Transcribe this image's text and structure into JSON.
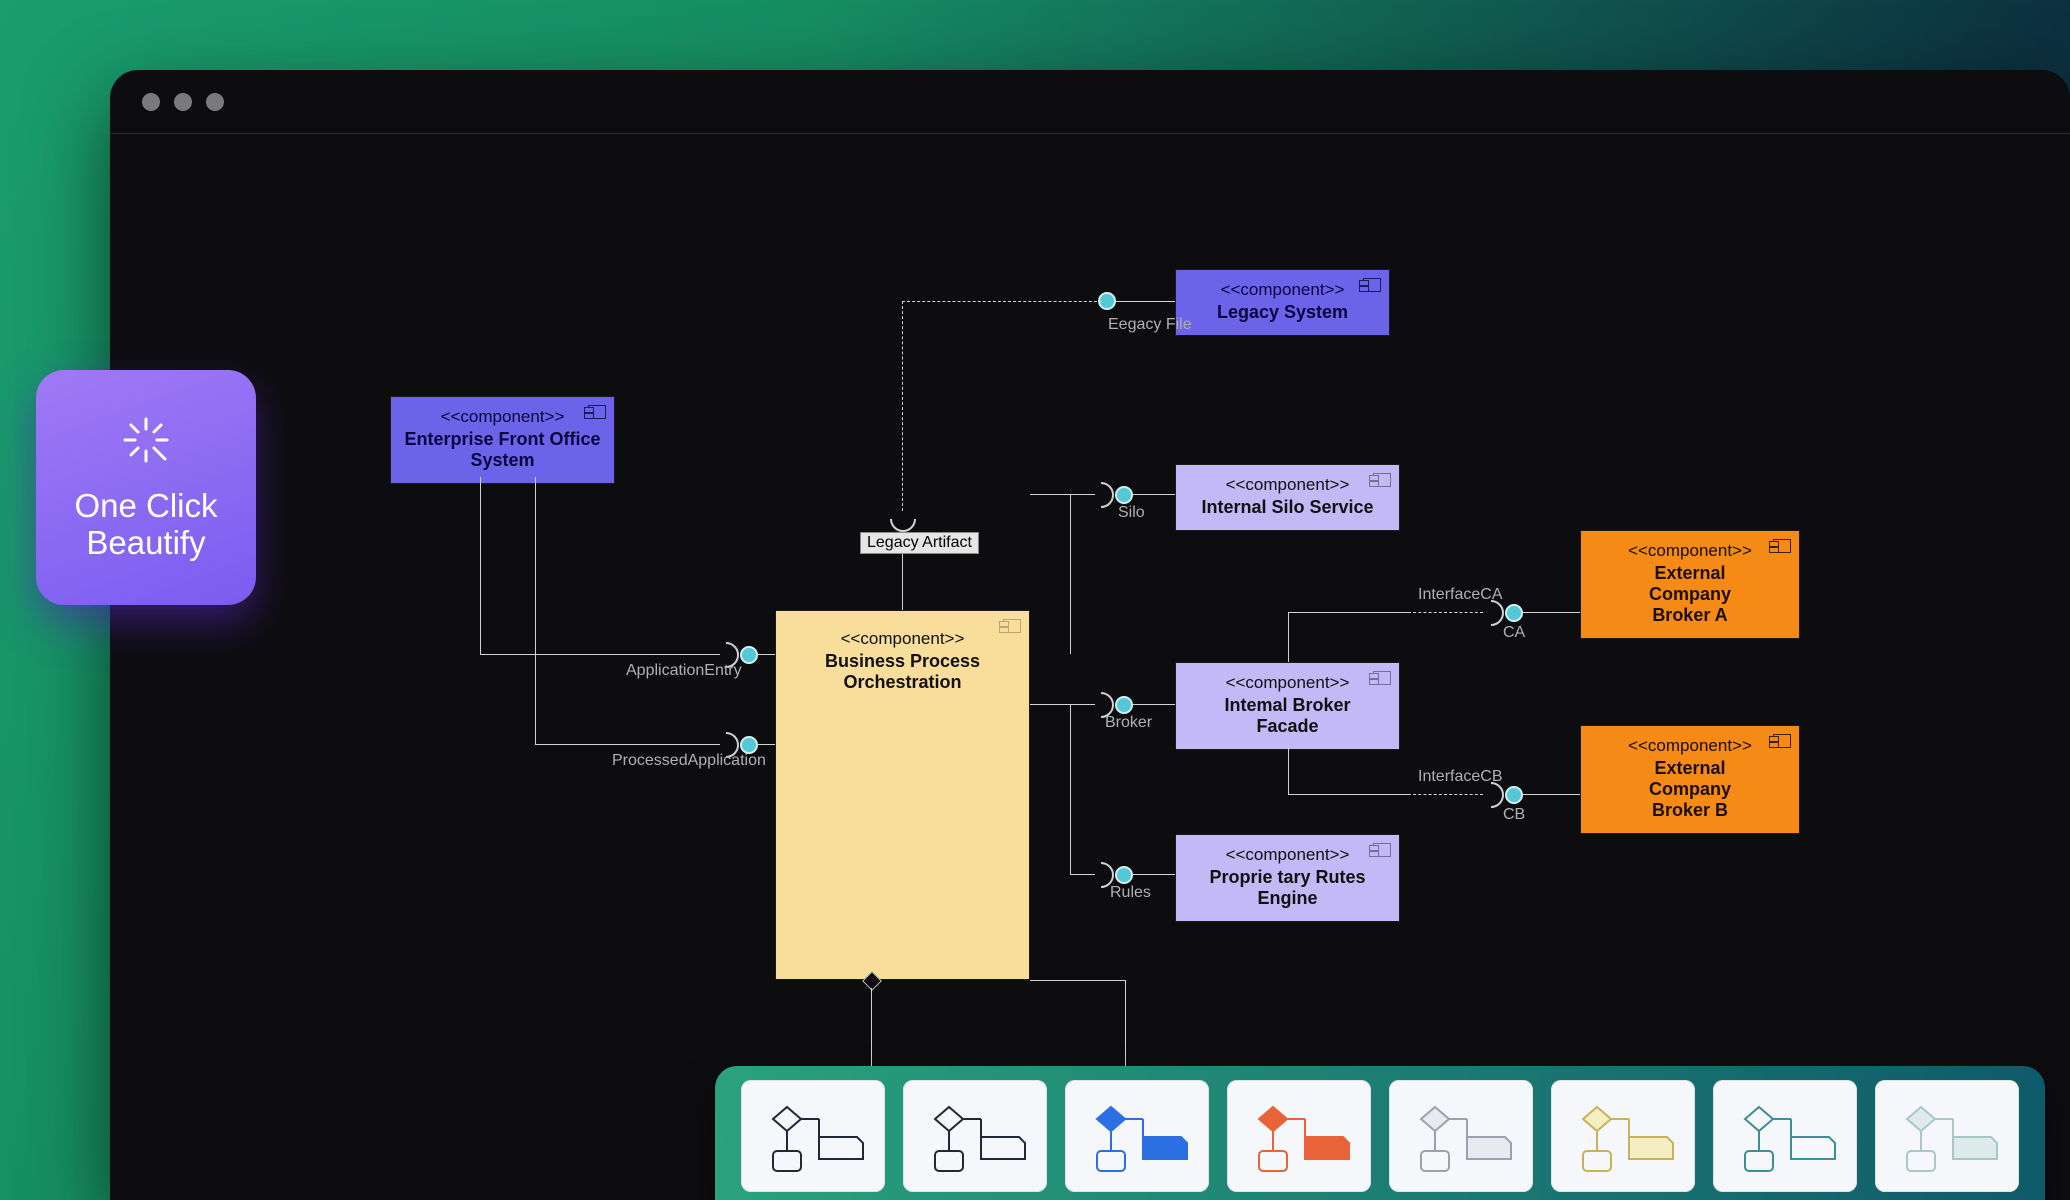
{
  "badge": {
    "line1": "One Click",
    "line2": "Beautify"
  },
  "stereo": "<<component>>",
  "components": {
    "efo": {
      "name": "Enterprise Front Office System"
    },
    "bpo": {
      "name": "Business Process Orchestration"
    },
    "legacy": {
      "name": "Legacy System"
    },
    "silo": {
      "name": "Internal Silo Service"
    },
    "broker": {
      "name": "Intemal Broker Facade"
    },
    "rules": {
      "name": "Proprie tary Rutes Engine"
    },
    "extA": {
      "name": "External Company Broker A"
    },
    "extB": {
      "name": "External Company Broker B"
    }
  },
  "labels": {
    "legacyArtifact": "Legacy Artifact",
    "eegacyFile": "Eegacy File",
    "applicationEntry": "ApplicationEntry",
    "processedApplication": "ProcessedApplication",
    "silo": "Silo",
    "broker": "Broker",
    "rules": "Rules",
    "interfaceCA": "InterfaceCA",
    "ca": "CA",
    "interfaceCB": "InterfaceCB",
    "cb": "CB"
  },
  "swatches": [
    {
      "id": "plain",
      "shape": "#1f2937",
      "fill": "none",
      "accent": "none"
    },
    {
      "id": "plain2",
      "shape": "#1f2937",
      "fill": "none",
      "accent": "none"
    },
    {
      "id": "blue",
      "shape": "#2b6fe3",
      "fill": "#2b6fe3",
      "accent": "#2b6fe3"
    },
    {
      "id": "orange",
      "shape": "#e8623a",
      "fill": "#e8623a",
      "accent": "#e8623a"
    },
    {
      "id": "gray",
      "shape": "#9aa3ad",
      "fill": "#e7ebef",
      "accent": "#9aa3ad"
    },
    {
      "id": "yellow",
      "shape": "#c7b25a",
      "fill": "#f5eec3",
      "accent": "#c7b25a"
    },
    {
      "id": "teal",
      "shape": "#3c8f95",
      "fill": "none",
      "accent": "#3c8f95"
    },
    {
      "id": "mint",
      "shape": "#a6c9c6",
      "fill": "#ddeceb",
      "accent": "#a6c9c6"
    }
  ]
}
